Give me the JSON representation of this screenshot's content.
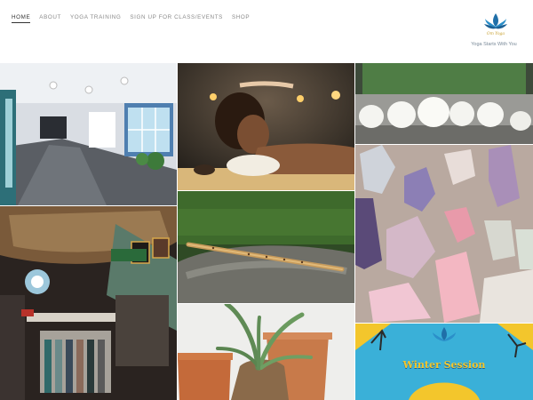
{
  "nav": {
    "items": [
      {
        "label": "HOME"
      },
      {
        "label": "ABOUT"
      },
      {
        "label": "YOGA TRAINING"
      },
      {
        "label": "SIGN UP FOR CLASS/EVENTS"
      },
      {
        "label": "SHOP"
      }
    ]
  },
  "brand": {
    "logo_text": "Om Yoga",
    "tagline": "Yoga Starts With You"
  },
  "gallery": {
    "tiles": [
      {
        "name": "studio-interior-photo",
        "icon": "yoga-studio"
      },
      {
        "name": "massage-session-photo",
        "icon": "relaxation"
      },
      {
        "name": "singing-bowls-photo",
        "icon": "singing-bowls"
      },
      {
        "name": "crystals-photo",
        "icon": "crystals"
      },
      {
        "name": "boutique-shop-photo",
        "icon": "shop"
      },
      {
        "name": "bamboo-flute-photo",
        "icon": "flute"
      },
      {
        "name": "aloe-plant-photo",
        "icon": "plant"
      }
    ],
    "winter_banner": {
      "title": "Winter Session"
    }
  },
  "colors": {
    "accent": "#2a8fbf",
    "banner_bg": "#3ab0d8",
    "banner_yellow": "#f3c62c"
  }
}
